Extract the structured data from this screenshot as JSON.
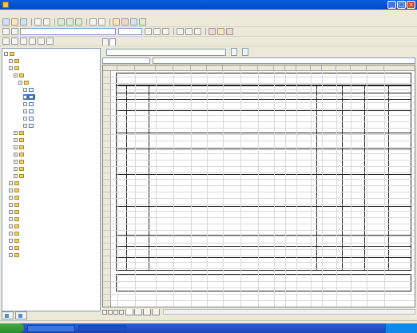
{
  "window": {
    "title": ""
  },
  "menubar": {
    "items": [
      "",
      "",
      "",
      "",
      "",
      "",
      ""
    ]
  },
  "left_tree": {
    "rows": [
      "",
      "",
      "",
      "",
      "",
      "",
      "",
      "",
      "",
      "",
      "",
      "",
      "",
      "",
      "",
      "",
      "",
      "",
      "",
      "",
      "",
      "",
      "",
      "",
      "",
      "",
      "",
      "",
      ""
    ]
  },
  "left_tabs": [
    "",
    ""
  ],
  "doc_tabs": [
    "",
    ""
  ],
  "path_bar": {
    "label": "",
    "value": "",
    "buttons": [
      "",
      ""
    ]
  },
  "formula_bar": {
    "cell": "",
    "content": ""
  },
  "sheet": {
    "columns": [
      "",
      "",
      "",
      "",
      "",
      "",
      "",
      "",
      "",
      "",
      "",
      "",
      "",
      "",
      "",
      "",
      "",
      ""
    ],
    "rows": [
      "",
      "",
      "",
      "",
      "",
      "",
      "",
      "",
      "",
      "",
      "",
      "",
      "",
      "",
      "",
      "",
      "",
      "",
      "",
      "",
      "",
      "",
      "",
      "",
      "",
      "",
      "",
      "",
      "",
      "",
      "",
      "",
      "",
      "",
      "",
      "",
      ""
    ]
  },
  "form": {
    "company": "",
    "title": ""
  },
  "sheet_tabs": [
    "",
    "",
    "",
    ""
  ],
  "taskbar": {
    "start": "",
    "tasks": [
      "",
      ""
    ],
    "clock": ""
  }
}
